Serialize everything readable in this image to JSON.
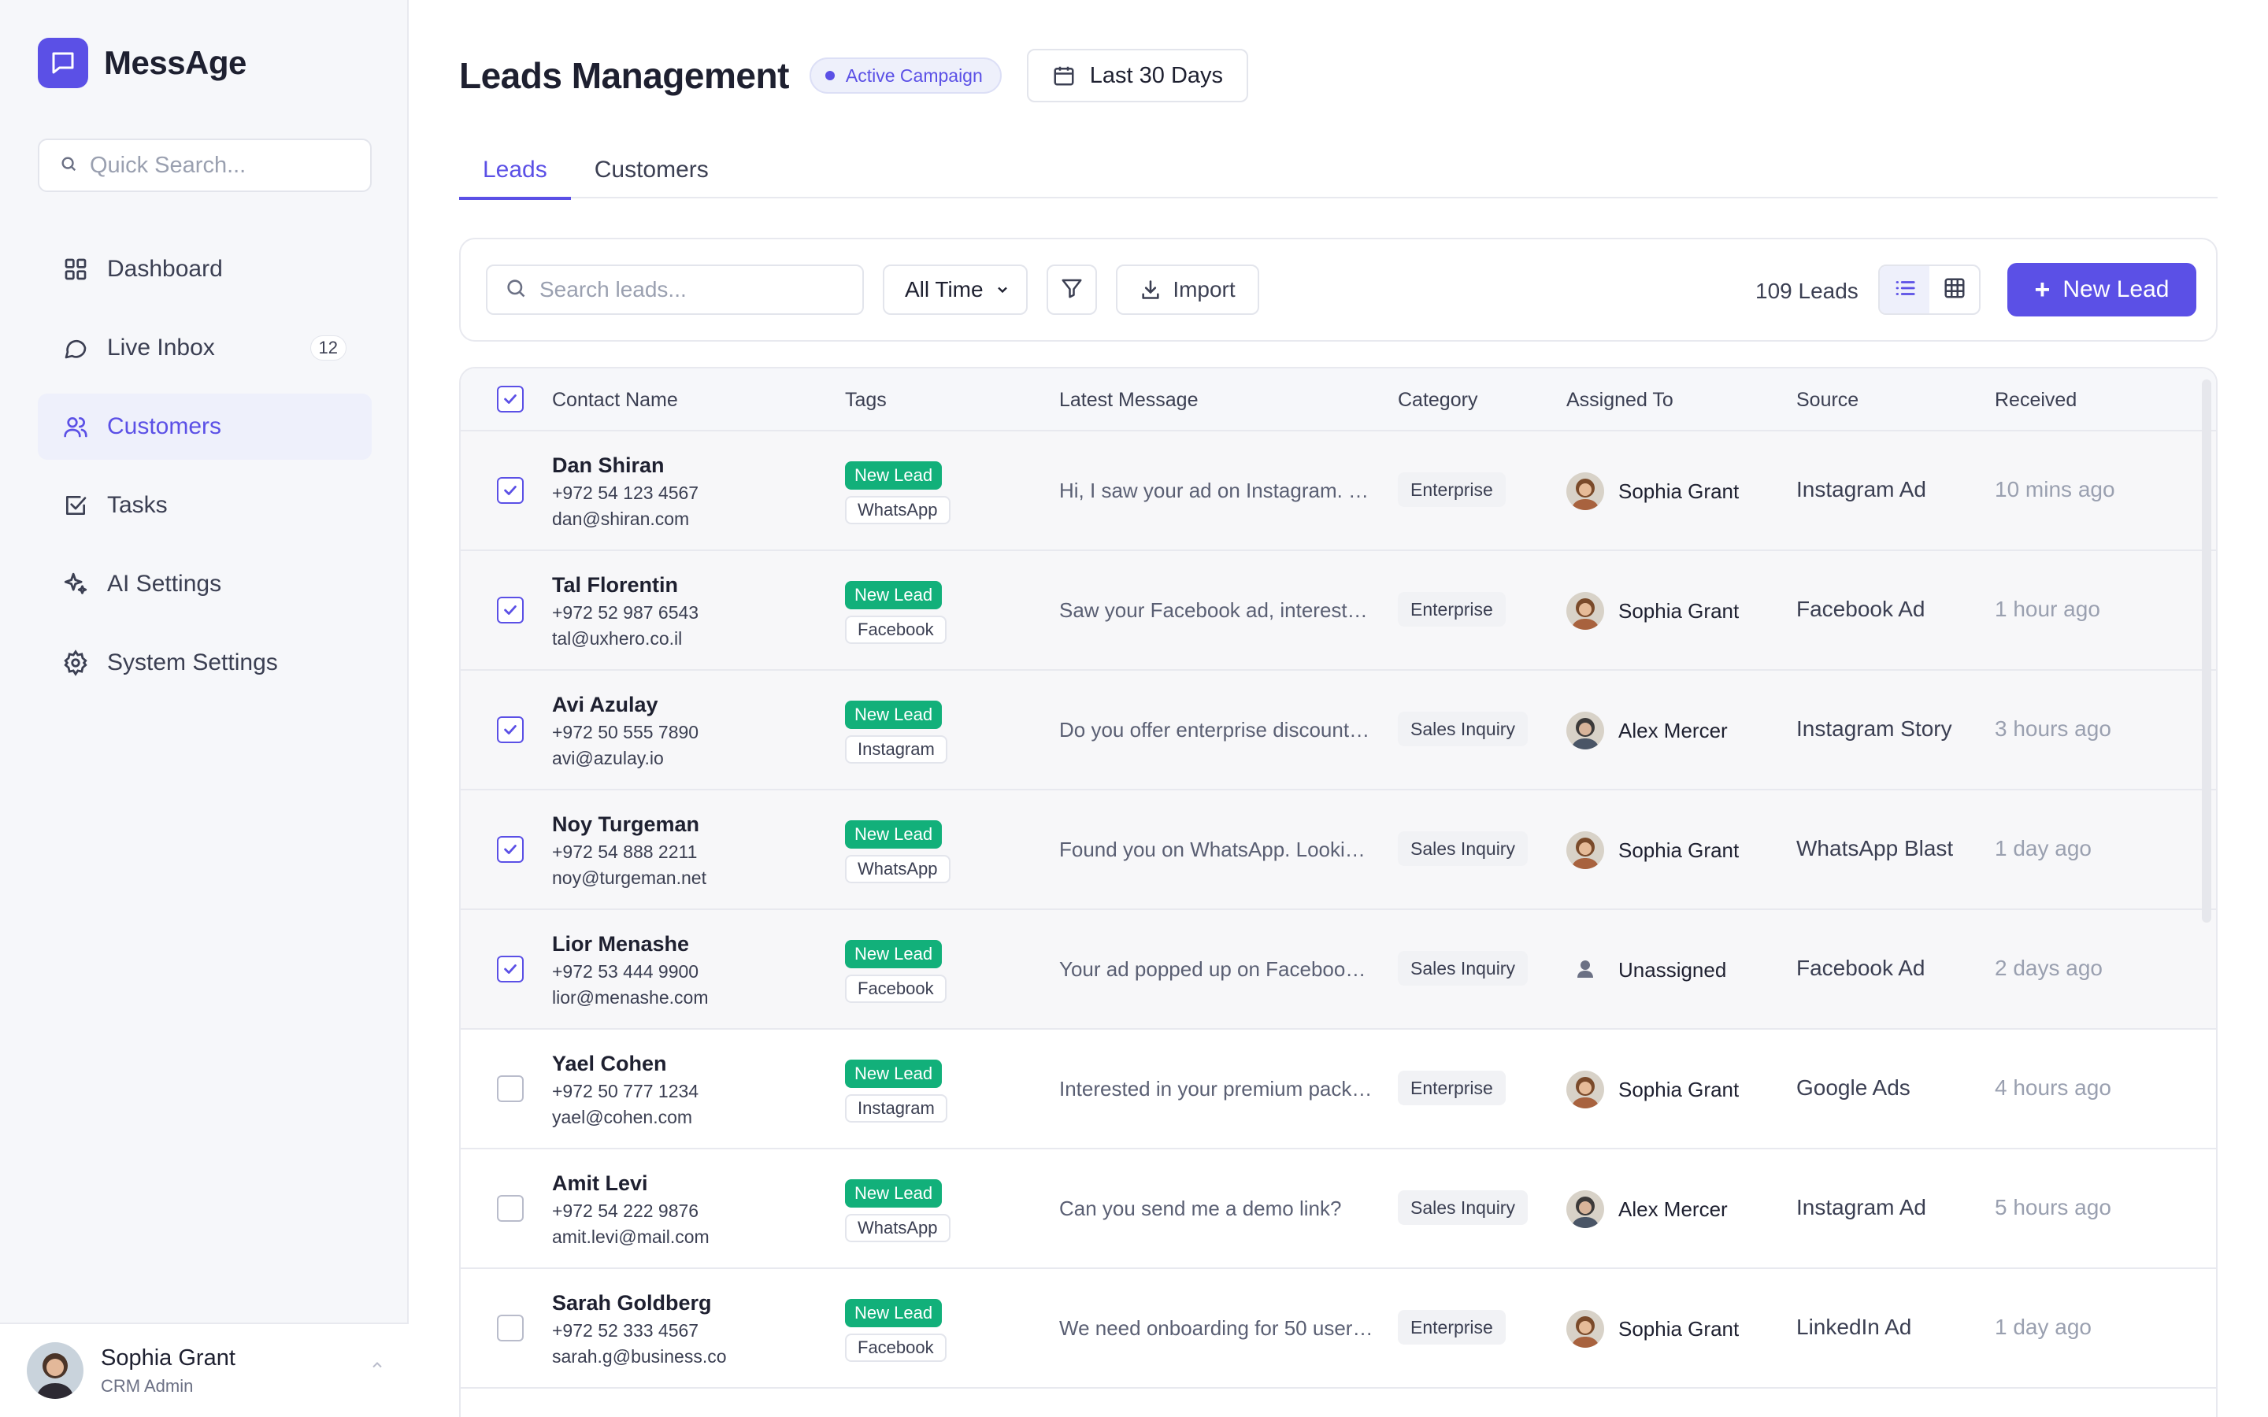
{
  "app": {
    "name": "MessAge"
  },
  "sidebar": {
    "search_placeholder": "Quick Search...",
    "items": [
      {
        "label": "Dashboard",
        "icon": "grid-icon"
      },
      {
        "label": "Live Inbox",
        "icon": "chat-bubble-icon",
        "badge": "12"
      },
      {
        "label": "Customers",
        "icon": "users-icon",
        "active": true
      },
      {
        "label": "Tasks",
        "icon": "checkbox-icon"
      },
      {
        "label": "AI Settings",
        "icon": "sparkles-icon"
      },
      {
        "label": "System Settings",
        "icon": "gear-icon"
      }
    ],
    "user": {
      "name": "Sophia Grant",
      "role": "CRM Admin"
    }
  },
  "header": {
    "title": "Leads Management",
    "campaign_badge": "Active Campaign",
    "date_range": "Last 30 Days"
  },
  "tabs": [
    {
      "label": "Leads",
      "active": true
    },
    {
      "label": "Customers",
      "active": false
    }
  ],
  "toolbar": {
    "search_placeholder": "Search leads...",
    "time_filter": "All Time",
    "import_label": "Import",
    "lead_count": "109 Leads",
    "new_lead_label": "New Lead",
    "active_view": "list"
  },
  "table": {
    "columns": [
      "Contact Name",
      "Tags",
      "Latest Message",
      "Category",
      "Assigned To",
      "Source",
      "Received"
    ],
    "header_checked": true,
    "rows": [
      {
        "name": "Dan Shiran",
        "phone": "+972 54 123 4567",
        "email": "dan@shiran.com",
        "tag": "New Lead",
        "channel": "WhatsApp",
        "message": "Hi, I saw your ad on Instagram. Ca...",
        "category": "Enterprise",
        "assignee": "Sophia Grant",
        "source": "Instagram Ad",
        "received": "10 mins ago",
        "checked": true
      },
      {
        "name": "Tal Florentin",
        "phone": "+972 52 987 6543",
        "email": "tal@uxhero.co.il",
        "tag": "New Lead",
        "channel": "Facebook",
        "message": "Saw your Facebook ad, interested...",
        "category": "Enterprise",
        "assignee": "Sophia Grant",
        "source": "Facebook Ad",
        "received": "1 hour ago",
        "checked": true
      },
      {
        "name": "Avi Azulay",
        "phone": "+972 50 555 7890",
        "email": "avi@azulay.io",
        "tag": "New Lead",
        "channel": "Instagram",
        "message": "Do you offer enterprise discounts...",
        "category": "Sales Inquiry",
        "assignee": "Alex Mercer",
        "source": "Instagram Story",
        "received": "3 hours ago",
        "checked": true
      },
      {
        "name": "Noy Turgeman",
        "phone": "+972 54 888 2211",
        "email": "noy@turgeman.net",
        "tag": "New Lead",
        "channel": "WhatsApp",
        "message": "Found you on WhatsApp. Looking...",
        "category": "Sales Inquiry",
        "assignee": "Sophia Grant",
        "source": "WhatsApp Blast",
        "received": "1 day ago",
        "checked": true
      },
      {
        "name": "Lior Menashe",
        "phone": "+972 53 444 9900",
        "email": "lior@menashe.com",
        "tag": "New Lead",
        "channel": "Facebook",
        "message": "Your ad popped up on Facebook....",
        "category": "Sales Inquiry",
        "assignee": "Unassigned",
        "source": "Facebook Ad",
        "received": "2 days ago",
        "checked": true
      },
      {
        "name": "Yael Cohen",
        "phone": "+972 50 777 1234",
        "email": "yael@cohen.com",
        "tag": "New Lead",
        "channel": "Instagram",
        "message": "Interested in your premium packa...",
        "category": "Enterprise",
        "assignee": "Sophia Grant",
        "source": "Google Ads",
        "received": "4 hours ago",
        "checked": false
      },
      {
        "name": "Amit Levi",
        "phone": "+972 54 222 9876",
        "email": "amit.levi@mail.com",
        "tag": "New Lead",
        "channel": "WhatsApp",
        "message": "Can you send me a demo link?",
        "category": "Sales Inquiry",
        "assignee": "Alex Mercer",
        "source": "Instagram Ad",
        "received": "5 hours ago",
        "checked": false
      },
      {
        "name": "Sarah Goldberg",
        "phone": "+972 52 333 4567",
        "email": "sarah.g@business.co",
        "tag": "New Lead",
        "channel": "Facebook",
        "message": "We need onboarding for 50 users...",
        "category": "Enterprise",
        "assignee": "Sophia Grant",
        "source": "LinkedIn Ad",
        "received": "1 day ago",
        "checked": false
      }
    ]
  },
  "colors": {
    "accent": "#5b50e6",
    "new_lead_tag": "#12b07a"
  }
}
